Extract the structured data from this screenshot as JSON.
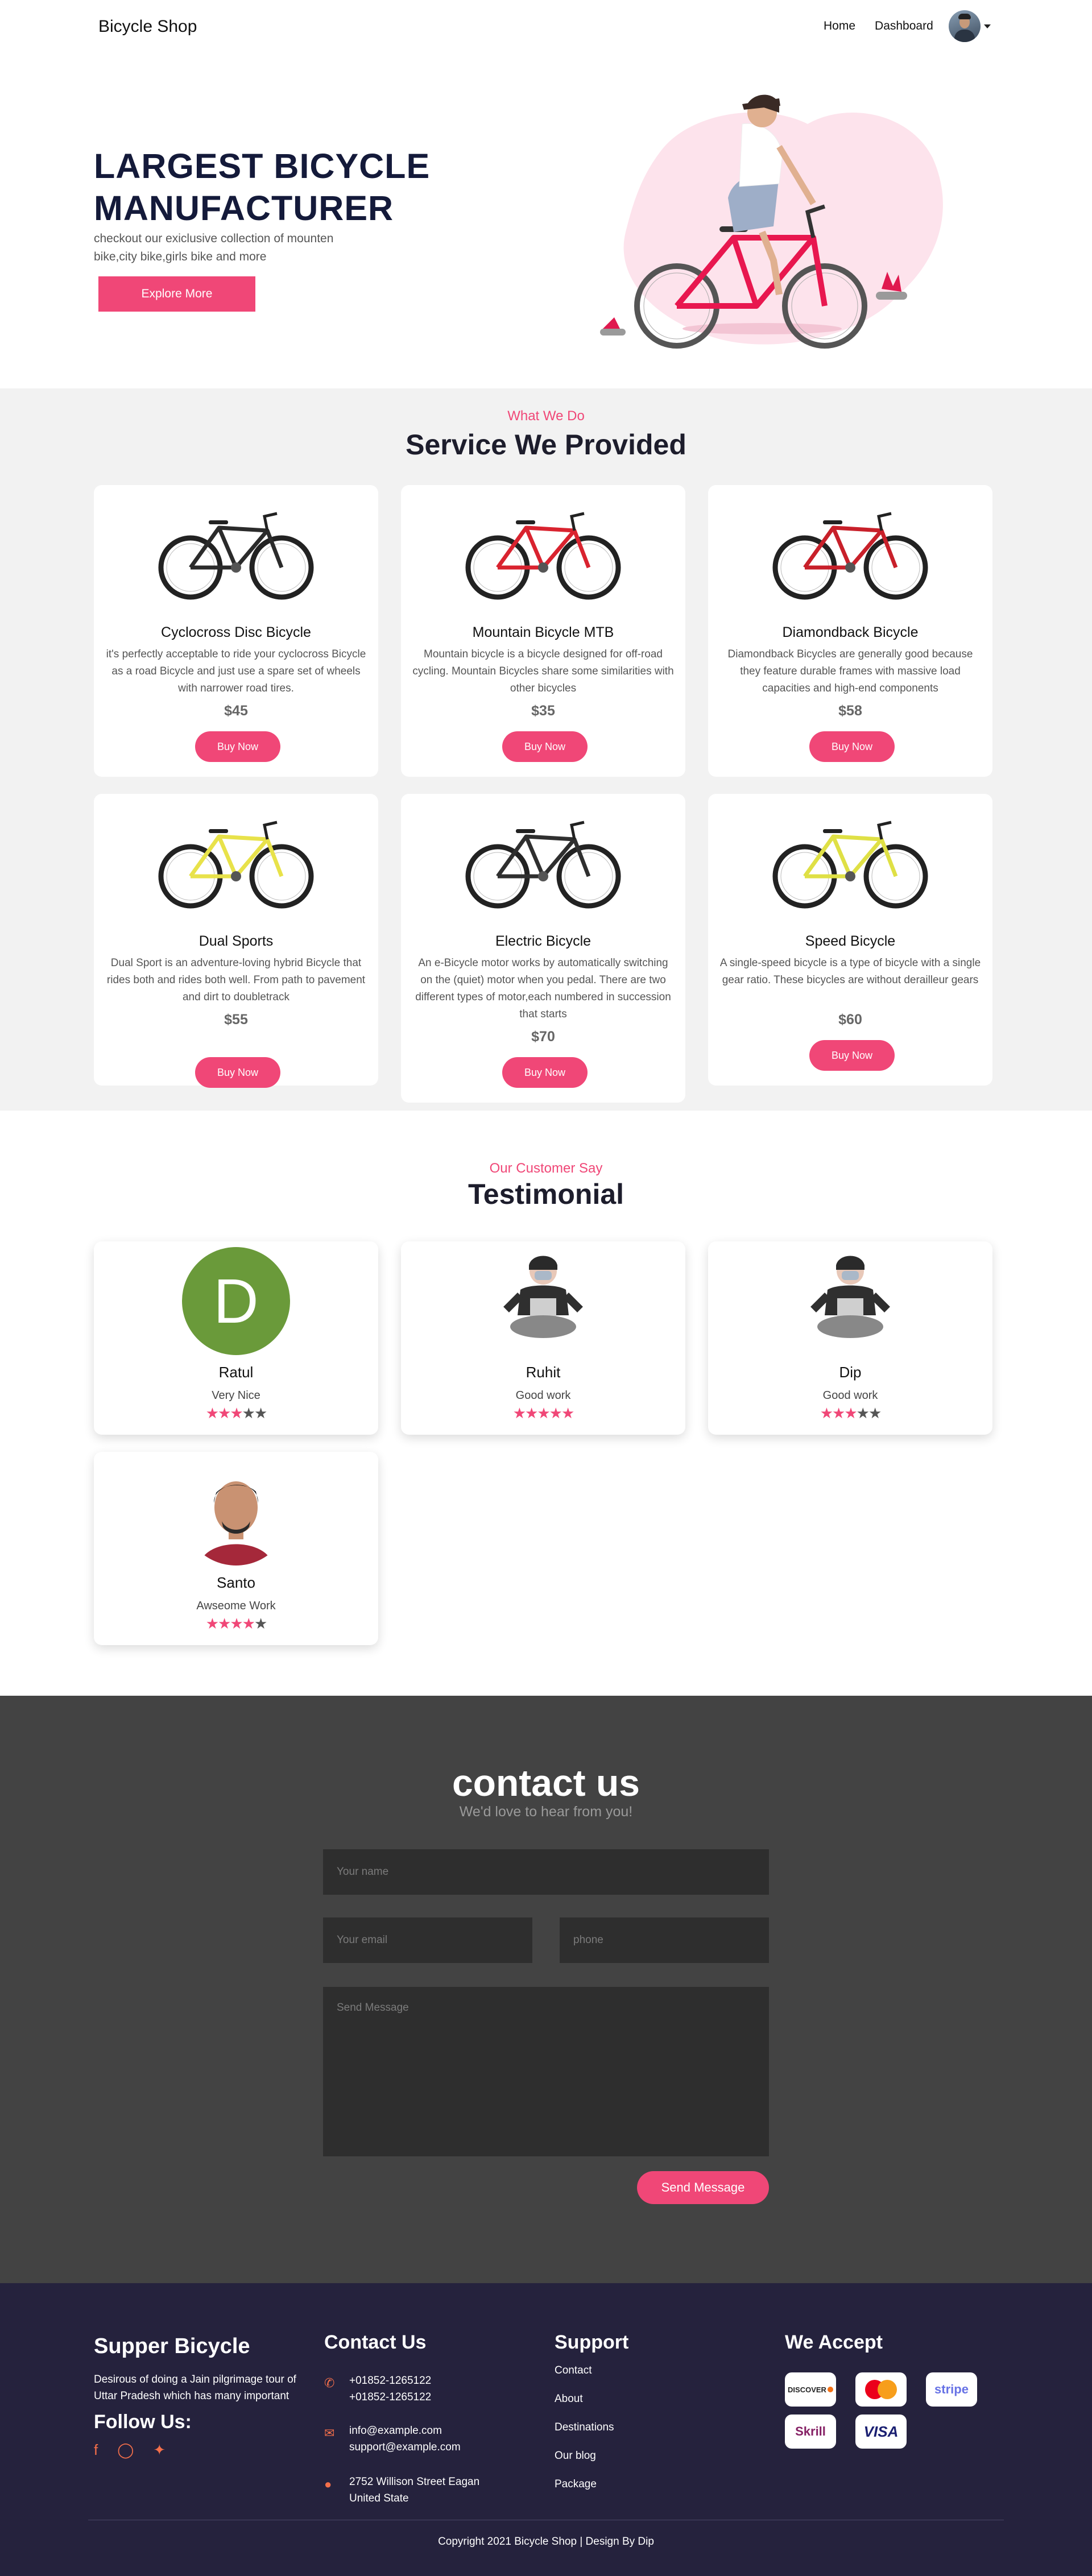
{
  "navbar": {
    "brand": "Bicycle Shop",
    "links": [
      "Home",
      "Dashboard"
    ]
  },
  "hero": {
    "title": "LARGEST BICYCLE MANUFACTURER",
    "subtitle": "checkout our exiclusive collection of mounten bike,city bike,girls bike and more",
    "button": "Explore More"
  },
  "services": {
    "eyebrow": "What We Do",
    "title": "Service We Provided",
    "buy_label": "Buy Now",
    "items": [
      {
        "name": "Cyclocross Disc Bicycle",
        "desc": "it's perfectly acceptable to ride your cyclocross Bicycle as a road Bicycle and just use a spare set of wheels with narrower road tires.",
        "price": "$45",
        "frame_color": "#2b2b2b"
      },
      {
        "name": "Mountain Bicycle MTB",
        "desc": "Mountain bicycle is a bicycle designed for off-road cycling. Mountain Bicycles share some similarities with other bicycles",
        "price": "$35",
        "frame_color": "#d9232f"
      },
      {
        "name": "Diamondback Bicycle",
        "desc": "Diamondback Bicycles are generally good because they feature durable frames with massive load capacities and high-end components",
        "price": "$58",
        "frame_color": "#c8202a"
      },
      {
        "name": "Dual Sports",
        "desc": "Dual Sport is an adventure-loving hybrid Bicycle that rides both and rides both well. From path to pavement and dirt to doubletrack",
        "price": "$55",
        "frame_color": "#e8e24a"
      },
      {
        "name": "Electric Bicycle",
        "desc": "An e-Bicycle motor works by automatically switching on the (quiet) motor when you pedal. There are two different types of motor,each numbered in succession that starts",
        "price": "$70",
        "frame_color": "#2f2f2f"
      },
      {
        "name": "Speed Bicycle",
        "desc": "A single-speed bicycle is a type of bicycle with a single gear ratio. These bicycles are without derailleur gears",
        "price": "$60",
        "frame_color": "#dfe045"
      }
    ]
  },
  "testimonials": {
    "eyebrow": "Our Customer Say",
    "title": "Testimonial",
    "items": [
      {
        "name": "Ratul",
        "quote": "Very Nice",
        "rating": 3,
        "initial": "D",
        "photo": "letter-avatar"
      },
      {
        "name": "Ruhit",
        "quote": "Good work",
        "rating": 5,
        "photo": "masked-person-illustration"
      },
      {
        "name": "Dip",
        "quote": "Good work",
        "rating": 3,
        "photo": "masked-person-illustration"
      },
      {
        "name": "Santo",
        "quote": "Awseome Work",
        "rating": 4,
        "photo": "man-portrait"
      }
    ]
  },
  "contact": {
    "title": "contact us",
    "subtitle": "We'd love to hear from you!",
    "name_placeholder": "Your name",
    "email_placeholder": "Your email",
    "phone_placeholder": "phone",
    "message_placeholder": "Send Message",
    "button": "Send Message"
  },
  "footer": {
    "brand": "Supper Bicycle",
    "about": "Desirous of doing a Jain pilgrimage tour of Uttar Pradesh which has many important",
    "follow": "Follow Us:",
    "contact_title": "Contact Us",
    "phones": [
      "+01852-1265122",
      "+01852-1265122"
    ],
    "emails": [
      "info@example.com",
      "support@example.com"
    ],
    "address": "2752 Willison Street Eagan United State",
    "support_title": "Support",
    "support_links": [
      "Contact",
      "About",
      "Destinations",
      "Our blog",
      "Package"
    ],
    "accept_title": "We Accept",
    "payments": [
      "DISCOVER",
      "mastercard",
      "stripe",
      "Skrill",
      "VISA"
    ],
    "copyright": "Copyright 2021 Bicycle Shop | Design By Dip"
  },
  "colors": {
    "accent": "#f04777",
    "footer_bg": "#25223d",
    "contact_bg": "#434343"
  }
}
